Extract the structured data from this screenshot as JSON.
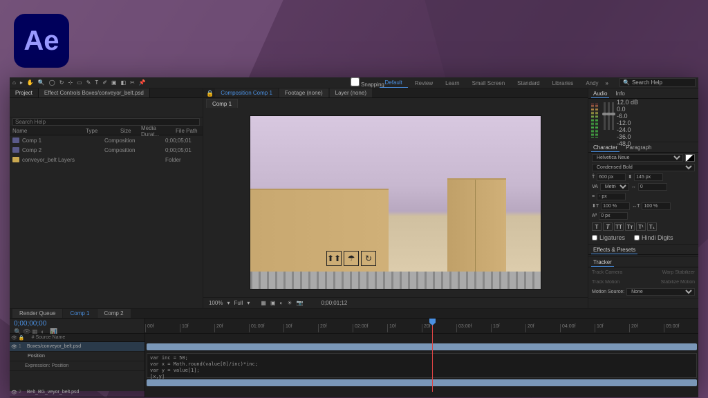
{
  "app_name": "Ae",
  "toolbar": {
    "snapping": "Snapping"
  },
  "workspaces": [
    "Default",
    "Review",
    "Learn",
    "Small Screen",
    "Standard",
    "Libraries",
    "Andy"
  ],
  "workspace_active": 0,
  "search_placeholder": "Search Help",
  "project_panel": {
    "tabs": [
      "Project",
      "Effect Controls Boxes/conveyor_belt.psd"
    ],
    "columns": {
      "name": "Name",
      "type": "Type",
      "size": "Size",
      "media": "Media Durat...",
      "file": "File Path"
    },
    "items": [
      {
        "name": "Comp 1",
        "type": "Composition",
        "media": "0;00;05;01",
        "icon": "comp"
      },
      {
        "name": "Comp 2",
        "type": "Composition",
        "media": "0;00;05;01",
        "icon": "comp"
      },
      {
        "name": "conveyor_belt Layers",
        "type": "Folder",
        "media": "",
        "icon": "folder"
      }
    ]
  },
  "composition": {
    "tabs": [
      "Composition Comp 1",
      "Footage (none)",
      "Layer (none)"
    ],
    "subtab": "Comp 1",
    "zoom": "100%",
    "quality": "Full",
    "timecode": "0;00;01;12"
  },
  "audio": {
    "tabs": [
      "Audio",
      "Info"
    ],
    "db": [
      "12.0 dB",
      "0.0",
      "-6.0",
      "-12.0",
      "-24.0",
      "-36.0",
      "-48.0"
    ]
  },
  "character": {
    "tabs": [
      "Character",
      "Paragraph"
    ],
    "font": "Helvetica Neue",
    "style": "Condensed Bold",
    "size": "600 px",
    "leading": "145 px",
    "metrics": "Metrics",
    "tracking": "0",
    "vscale": "100 %",
    "hscale": "100 %",
    "baseline": "0 px",
    "stroke": "- px",
    "ligatures": "Ligatures",
    "hindi": "Hindi Digits"
  },
  "effects": {
    "title": "Effects & Presets"
  },
  "tracker": {
    "title": "Tracker",
    "source_label": "Motion Source:",
    "source": "None",
    "btns": [
      "Track Camera",
      "Warp Stabilizer",
      "Track Motion",
      "Stabilize Motion"
    ]
  },
  "timeline": {
    "tabs": [
      "Render Queue",
      "Comp 1",
      "Comp 2"
    ],
    "active_tab": 1,
    "timecode": "0;00;00;00",
    "ruler": [
      "00f",
      "10f",
      "20f",
      "01:00f",
      "10f",
      "20f",
      "02:00f",
      "10f",
      "20f",
      "03:00f",
      "10f",
      "20f",
      "04:00f",
      "10f",
      "20f",
      "05:00f"
    ],
    "layer_header": {
      "num": "#",
      "name": "Source Name"
    },
    "layers": [
      {
        "num": "1",
        "name": "Boxes/conveyor_belt.psd",
        "sel": true
      },
      {
        "num": "",
        "name": "Position",
        "sel": false,
        "sub": true
      },
      {
        "num": "",
        "name": "Expression: Position",
        "sel": false,
        "expr": true
      },
      {
        "num": "2",
        "name": "Belt_BG_veyor_belt.psd",
        "sel": false
      }
    ],
    "expression": "var inc = 50;\nvar x = Math.round(value[0]/inc)*inc;\nvar y = value[1];\n[x,y]"
  }
}
